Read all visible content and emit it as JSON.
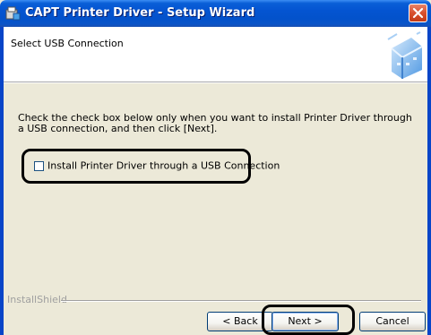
{
  "window": {
    "title": "CAPT Printer Driver - Setup Wizard",
    "icon": "installer-icon",
    "close_icon": "close-icon"
  },
  "header": {
    "title": "Select USB Connection",
    "graphic": "printer-graphic-icon"
  },
  "body": {
    "instructions": "Check the check box below only when you want to install Printer Driver through a USB connection, and then click [Next].",
    "checkbox": {
      "label": "Install Printer Driver through a USB Connection",
      "checked": false
    }
  },
  "footer": {
    "brand": "InstallShield",
    "back_label": "< Back",
    "next_label": "Next >",
    "cancel_label": "Cancel"
  },
  "colors": {
    "titlebar": "#0a54d1",
    "dialog_bg": "#ece9d8",
    "callout": "#000000"
  }
}
